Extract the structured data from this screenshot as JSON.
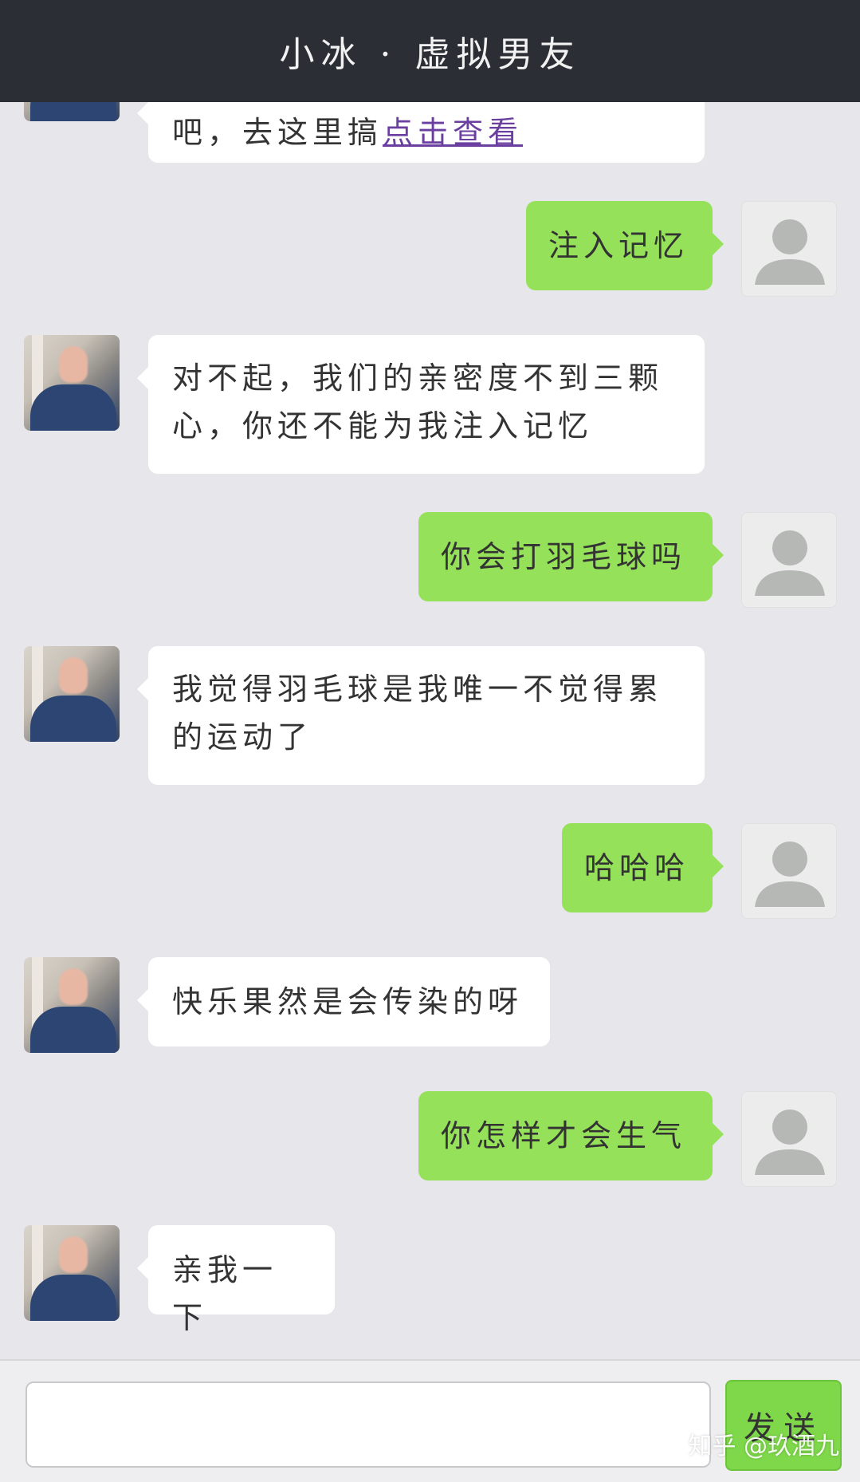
{
  "header": {
    "title": "小冰 · 虚拟男友"
  },
  "messages": [
    {
      "side": "left",
      "text": "吧，去这里搞",
      "link": "点击查看"
    },
    {
      "side": "right",
      "text": "注入记忆"
    },
    {
      "side": "left",
      "text": "对不起，我们的亲密度不到三颗心，你还不能为我注入记忆"
    },
    {
      "side": "right",
      "text": "你会打羽毛球吗"
    },
    {
      "side": "left",
      "text": "我觉得羽毛球是我唯一不觉得累的运动了"
    },
    {
      "side": "right",
      "text": "哈哈哈"
    },
    {
      "side": "left",
      "text": "快乐果然是会传染的呀"
    },
    {
      "side": "right",
      "text": "你怎样才会生气"
    },
    {
      "side": "left",
      "text": "亲我一下"
    }
  ],
  "footer": {
    "input_value": "",
    "send_label": "发送"
  },
  "watermark": "知乎 @玖酒九",
  "colors": {
    "header_bg": "#2b2f35",
    "right_bubble": "#95e15a",
    "left_bubble": "#ffffff",
    "background": "#e6e6eb"
  }
}
